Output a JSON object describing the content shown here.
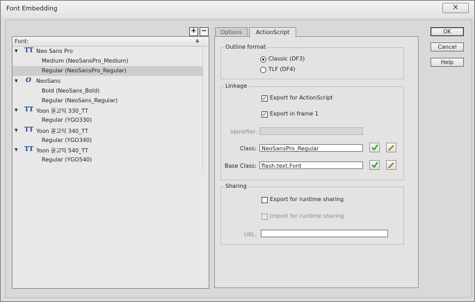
{
  "window": {
    "title": "Font Embedding",
    "close_glyph": "✕"
  },
  "toolbar": {
    "add_label": "+",
    "remove_label": "−"
  },
  "fontlist": {
    "header": "Font:",
    "rows": [
      {
        "label": "Neo Sans Pro",
        "type": "family",
        "icon": "truetype-font-icon"
      },
      {
        "label": "Medium (NeoSansPro_Medium)",
        "type": "child"
      },
      {
        "label": "Regular (NeoSansPro_Regular)",
        "type": "child",
        "selected": true
      },
      {
        "label": "NeoSans",
        "type": "family",
        "icon": "opentype-font-icon"
      },
      {
        "label": "Bold (NeoSans_Bold)",
        "type": "child"
      },
      {
        "label": "Regular (NeoSans_Regular)",
        "type": "child"
      },
      {
        "label": "Yoon 윤고딕 330_TT",
        "type": "family",
        "icon": "truetype-font-icon"
      },
      {
        "label": "Regular (YGO330)",
        "type": "child"
      },
      {
        "label": "Yoon 윤고딕 340_TT",
        "type": "family",
        "icon": "truetype-font-icon"
      },
      {
        "label": "Regular (YGO340)",
        "type": "child"
      },
      {
        "label": "Yoon 윤고딕 540_TT",
        "type": "family",
        "icon": "truetype-font-icon"
      },
      {
        "label": "Regular (YGO540)",
        "type": "child"
      }
    ]
  },
  "tabs": [
    {
      "label": "Options",
      "active": false
    },
    {
      "label": "ActionScript",
      "active": true
    }
  ],
  "outline_format": {
    "title": "Outline format",
    "classic_label": "Classic (DF3)",
    "classic_checked": true,
    "tlf_label": "TLF (DF4)",
    "tlf_checked": false
  },
  "linkage": {
    "title": "Linkage",
    "export_as_label": "Export for ActionScript",
    "export_as_checked": true,
    "export_frame_label": "Export in frame 1",
    "export_frame_checked": true,
    "identifier_label": "Identifier:",
    "identifier_value": "",
    "class_label": "Class:",
    "class_value": "NeoSansPro_Regular",
    "base_class_label": "Base Class:",
    "base_class_value": "flash.text.Font"
  },
  "sharing": {
    "title": "Sharing",
    "export_runtime_label": "Export for runtime sharing",
    "export_runtime_checked": false,
    "import_runtime_label": "Import for runtime sharing",
    "import_runtime_checked": false,
    "url_label": "URL:",
    "url_value": ""
  },
  "buttons": {
    "ok": "OK",
    "cancel": "Cancel",
    "help": "Help"
  },
  "colors": {
    "validate_check": "#3a9a2f",
    "font_icon": "#233b8c",
    "edit_pencil": "#b07020"
  }
}
